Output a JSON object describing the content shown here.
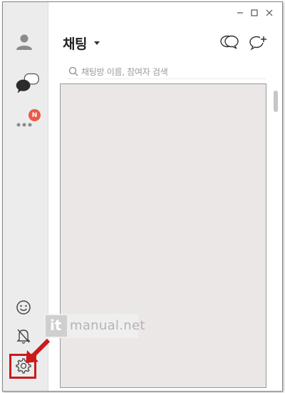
{
  "window": {
    "controls": [
      {
        "name": "minimize",
        "glyph": "–"
      },
      {
        "name": "maximize",
        "glyph": "□"
      },
      {
        "name": "close",
        "glyph": "✕"
      }
    ]
  },
  "sidebar": {
    "items": [
      {
        "name": "friends",
        "icon": "person-icon"
      },
      {
        "name": "chats",
        "icon": "chat-bubbles-icon"
      },
      {
        "name": "more",
        "icon": "more-dots-icon",
        "badge": "N"
      }
    ],
    "bottom": [
      {
        "name": "emoticon",
        "icon": "smiley-icon"
      },
      {
        "name": "notifications",
        "icon": "bell-muted-icon"
      },
      {
        "name": "settings",
        "icon": "gear-icon"
      }
    ]
  },
  "header": {
    "title": "채팅",
    "actions": [
      {
        "name": "open-chat",
        "icon": "speech-bubbles-icon"
      },
      {
        "name": "new-chat",
        "icon": "chat-plus-icon"
      }
    ]
  },
  "search": {
    "placeholder": "채팅방 이름, 참여자 검색"
  },
  "watermark": {
    "logo": "it",
    "text": "manual.net"
  },
  "colors": {
    "badge": "#ea5a4a",
    "highlight": "#cc1a1a",
    "list_bg": "#ebe7e6",
    "sidebar_bg": "#ececec"
  }
}
